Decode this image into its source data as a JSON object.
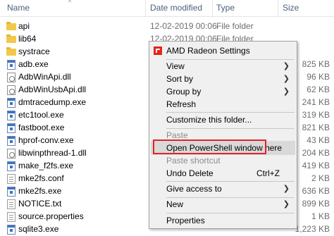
{
  "header": {
    "name": "Name",
    "date_modified": "Date modified",
    "type": "Type",
    "size": "Size",
    "sort_icon": "chevron-up-icon"
  },
  "files": [
    {
      "name": "api",
      "date": "12-02-2019 00:06",
      "type": "File folder",
      "size": "",
      "icon": "folder"
    },
    {
      "name": "lib64",
      "date": "12-02-2019 00:06",
      "type": "File folder",
      "size": "",
      "icon": "folder"
    },
    {
      "name": "systrace",
      "date": "",
      "type": "",
      "size": "",
      "icon": "folder"
    },
    {
      "name": "adb.exe",
      "date": "",
      "type": "",
      "size": "825 KB",
      "icon": "exe"
    },
    {
      "name": "AdbWinApi.dll",
      "date": "",
      "type": "",
      "size": "96 KB",
      "icon": "dll"
    },
    {
      "name": "AdbWinUsbApi.dll",
      "date": "",
      "type": "",
      "size": "62 KB",
      "icon": "dll"
    },
    {
      "name": "dmtracedump.exe",
      "date": "",
      "type": "",
      "size": "241 KB",
      "icon": "exe"
    },
    {
      "name": "etc1tool.exe",
      "date": "",
      "type": "",
      "size": "319 KB",
      "icon": "exe"
    },
    {
      "name": "fastboot.exe",
      "date": "",
      "type": "",
      "size": "821 KB",
      "icon": "exe"
    },
    {
      "name": "hprof-conv.exe",
      "date": "",
      "type": "",
      "size": "43 KB",
      "icon": "exe"
    },
    {
      "name": "libwinpthread-1.dll",
      "date": "",
      "type": "",
      "size": "204 KB",
      "icon": "dll"
    },
    {
      "name": "make_f2fs.exe",
      "date": "",
      "type": "",
      "size": "419 KB",
      "icon": "exe"
    },
    {
      "name": "mke2fs.conf",
      "date": "",
      "type": "",
      "size": "2 KB",
      "icon": "doc"
    },
    {
      "name": "mke2fs.exe",
      "date": "",
      "type": "",
      "size": "636 KB",
      "icon": "exe"
    },
    {
      "name": "NOTICE.txt",
      "date": "",
      "type": "",
      "size": "899 KB",
      "icon": "doc"
    },
    {
      "name": "source.properties",
      "date": "",
      "type": "",
      "size": "1 KB",
      "icon": "doc"
    },
    {
      "name": "sqlite3.exe",
      "date": "",
      "type": "",
      "size": "1,223 KB",
      "icon": "exe"
    }
  ],
  "context_menu": {
    "items": [
      {
        "label": "AMD Radeon Settings",
        "icon": "amd-logo-icon"
      },
      {
        "label": "View",
        "submenu": true
      },
      {
        "label": "Sort by",
        "submenu": true
      },
      {
        "label": "Group by",
        "submenu": true
      },
      {
        "label": "Refresh"
      },
      {
        "label": "Customize this folder..."
      },
      {
        "label": "Paste",
        "disabled": true
      },
      {
        "label": "Open PowerShell window here",
        "highlighted": true
      },
      {
        "label": "Paste shortcut",
        "disabled": true
      },
      {
        "label": "Undo Delete",
        "shortcut": "Ctrl+Z"
      },
      {
        "label": "Give access to",
        "submenu": true
      },
      {
        "label": "New",
        "submenu": true
      },
      {
        "label": "Properties"
      }
    ],
    "submenu_arrow": "chevron-right-icon"
  },
  "colors": {
    "highlight_border": "#e0242a",
    "amd_red": "#e3241b",
    "folder_yellow": "#f3c84a"
  }
}
